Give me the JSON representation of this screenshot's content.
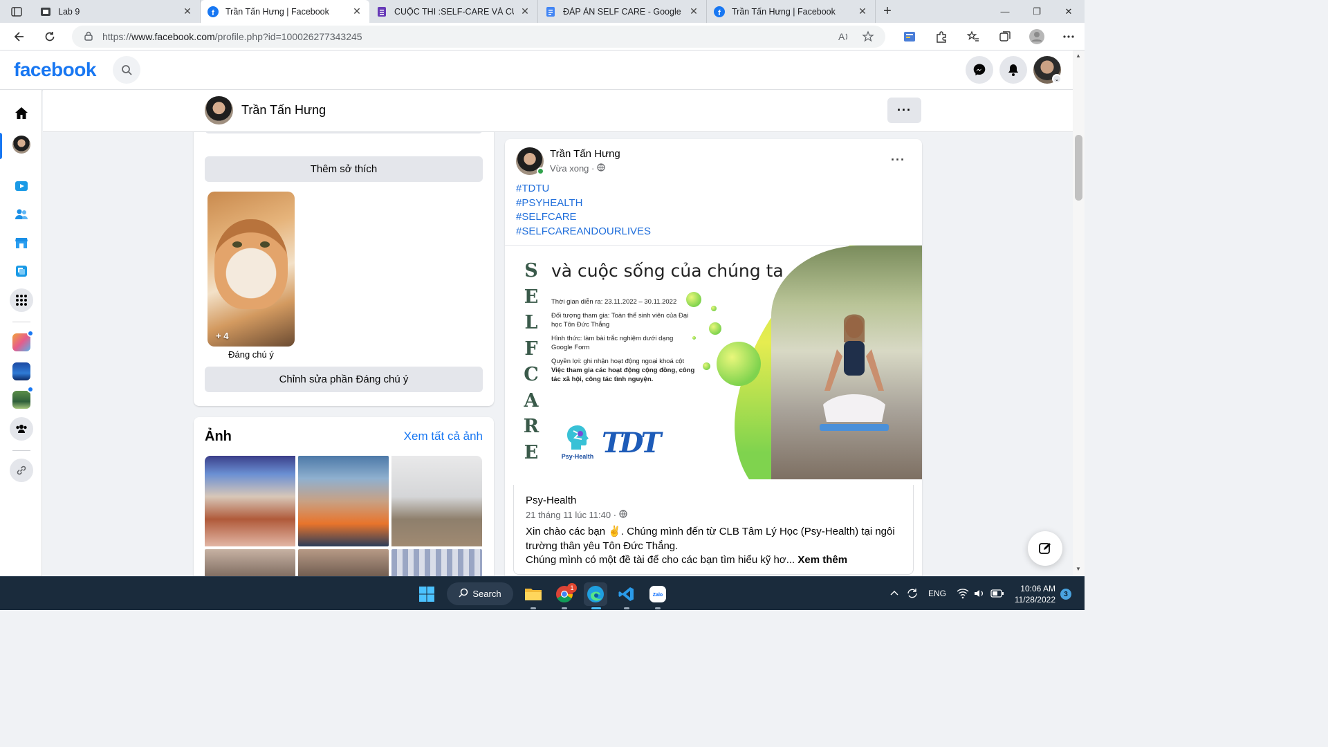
{
  "browser": {
    "tabs": [
      {
        "title": "Lab 9",
        "icon": "document-icon",
        "active": false
      },
      {
        "title": "Trần Tấn Hưng | Facebook",
        "icon": "facebook-icon",
        "active": true
      },
      {
        "title": "CUỘC THI :SELF-CARE VÀ CUỘC",
        "icon": "forms-icon",
        "active": false
      },
      {
        "title": "ĐÁP ÁN SELF CARE - Google Tài",
        "icon": "docs-icon",
        "active": false
      },
      {
        "title": "Trần Tấn Hưng | Facebook",
        "icon": "facebook-icon",
        "active": false
      }
    ],
    "url_prefix": "https://",
    "url_host": "www.facebook.com",
    "url_path": "/profile.php?id=100026277343245"
  },
  "facebook": {
    "logo": "facebook",
    "profile_name": "Trần Tấn Hưng"
  },
  "left_column": {
    "add_hobbies_button": "Thêm sở thích",
    "featured_count": "+ 4",
    "featured_label": "Đáng chú ý",
    "edit_featured_button": "Chỉnh sửa phần Đáng chú ý",
    "photos_title": "Ảnh",
    "photos_link": "Xem tất cả ảnh"
  },
  "post": {
    "author": "Trần Tấn Hưng",
    "time": "Vừa xong ·",
    "hashtags": [
      "#TDTU",
      "#PSYHEALTH",
      "#SELFCARE",
      "#SELFCAREANDOURLIVES"
    ],
    "banner": {
      "vertical_letters": [
        "S",
        "E",
        "L",
        "F",
        "C",
        "A",
        "R",
        "E"
      ],
      "title": "và cuộc sống của chúng ta",
      "info_time": "Thời gian diễn ra: 23.11.2022 – 30.11.2022",
      "info_target": "Đối tượng tham gia: Toàn thể sinh viên của Đại học Tôn Đức Thắng",
      "info_format": "Hình thức: làm bài trắc nghiệm dưới dạng Google Form",
      "info_benefit": "Quyền lợi: ghi nhận hoạt động ngoại khoá cột",
      "info_benefit_bold": "Việc tham gia các hoạt động cộng đồng, công tác xã hội, công tác tình nguyện.",
      "logo_psy": "Psy-Health",
      "logo_tdt": "TDT"
    },
    "shared": {
      "page_name": "Psy-Health",
      "time": "21 tháng 11 lúc 11:40 ·",
      "body": "Xin chào các bạn ✌️. Chúng mình đến từ CLB Tâm Lý Học (Psy-Health) tại ngôi trường thân yêu Tôn Đức Thắng.",
      "body2": "Chúng mình có một đề tài để cho các bạn tìm hiểu kỹ hơ...",
      "see_more": "Xem thêm"
    }
  },
  "taskbar": {
    "search_label": "Search",
    "language": "ENG",
    "time": "10:06 AM",
    "date": "11/28/2022",
    "notification_count": "3",
    "chrome_badge": "1"
  },
  "colors": {
    "facebook_blue": "#1877f2",
    "hashtag": "#216fdb",
    "taskbar": "#1a2b3c"
  }
}
